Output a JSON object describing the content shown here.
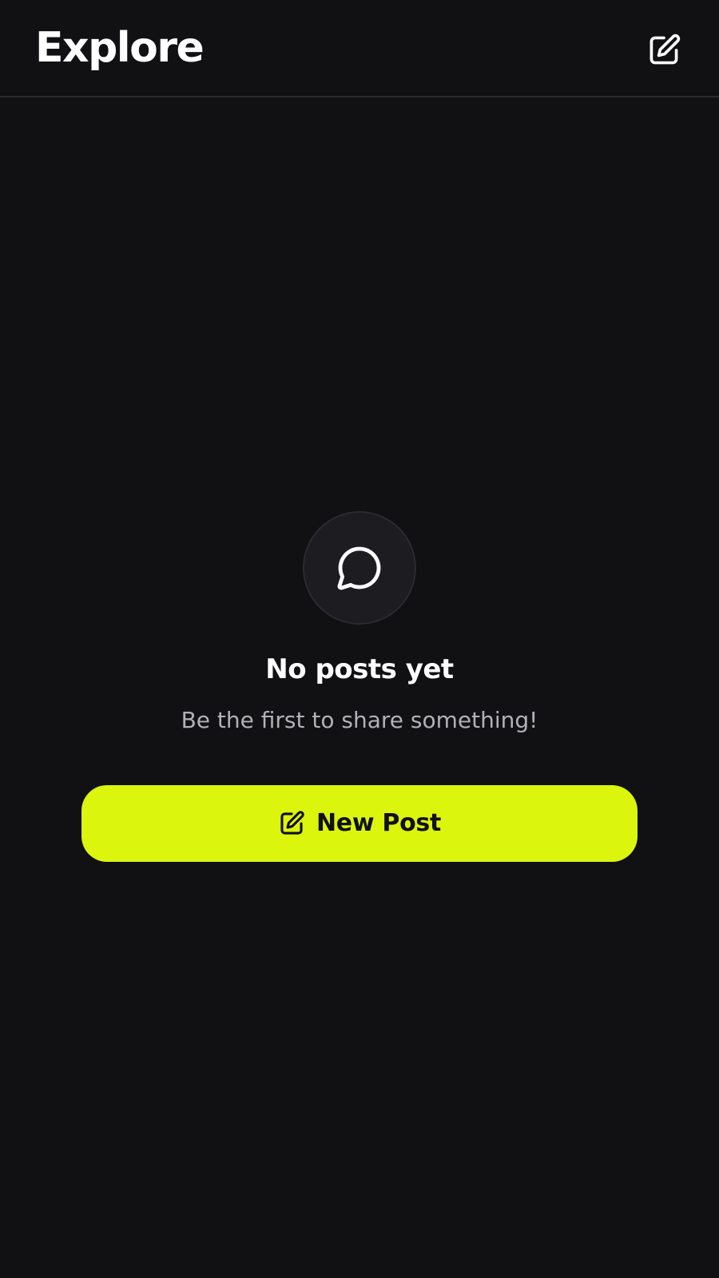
{
  "header": {
    "title": "Explore",
    "compose_icon": "compose-icon"
  },
  "empty_state": {
    "icon": "chat-bubble-icon",
    "title": "No posts yet",
    "subtitle": "Be the first to share something!",
    "button_label": "New Post",
    "button_icon": "compose-icon"
  },
  "colors": {
    "background": "#111013",
    "accent": "#dbf50c",
    "text_primary": "#ffffff",
    "text_secondary": "#b3b1b6",
    "divider": "#2a292d"
  }
}
